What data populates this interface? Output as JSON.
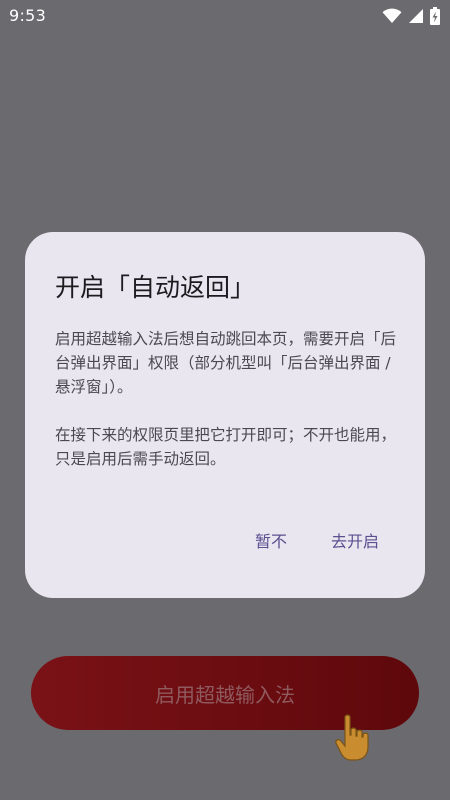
{
  "status_bar": {
    "time": "9:53",
    "icons": [
      "wifi-icon",
      "cellular-signal-icon",
      "battery-charging-icon"
    ]
  },
  "dialog": {
    "title": "开启「自动返回」",
    "paragraph_1": "启用超越输入法后想自动跳回本页，需要开启「后台弹出界面」权限（部分机型叫「后台弹出界面 / 悬浮窗」）。",
    "paragraph_2": "在接下来的权限页里把它打开即可；不开也能用，只是启用后需手动返回。",
    "cancel_label": "暂不",
    "confirm_label": "去开启"
  },
  "main": {
    "enable_button_label": "启用超越输入法",
    "hint_icon": "pointing-hand-icon"
  },
  "colors": {
    "scrim": "#6b6a6e",
    "dialog_bg": "#eae6f0",
    "accent": "#5b4f8f",
    "button_bg": "#6e0e12"
  }
}
